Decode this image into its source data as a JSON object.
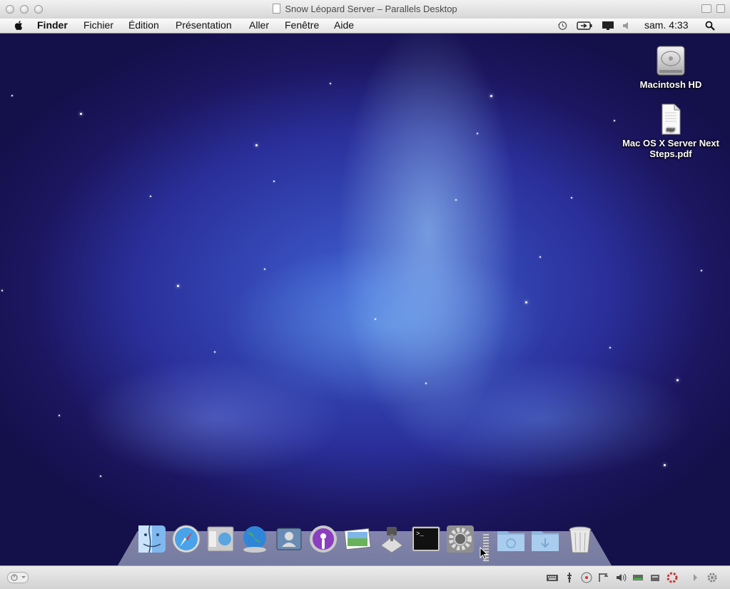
{
  "window": {
    "title": "Snow Léopard Server – Parallels Desktop"
  },
  "menubar": {
    "app_name": "Finder",
    "items": [
      "Fichier",
      "Édition",
      "Présentation",
      "Aller",
      "Fenêtre",
      "Aide"
    ],
    "clock": "sam. 4:33"
  },
  "desktop": {
    "icons": [
      {
        "label": "Macintosh HD",
        "icon": "hard-drive-icon"
      },
      {
        "label": "Mac OS X Server Next Steps.pdf",
        "icon": "pdf-document-icon",
        "badge": "PDF"
      }
    ]
  },
  "dock": {
    "items": [
      {
        "name": "finder",
        "icon": "finder-icon"
      },
      {
        "name": "safari",
        "icon": "safari-compass-icon"
      },
      {
        "name": "preview",
        "icon": "preview-icon"
      },
      {
        "name": "globe",
        "icon": "globe-icon"
      },
      {
        "name": "directory",
        "icon": "directory-icon"
      },
      {
        "name": "podcast",
        "icon": "podcast-icon"
      },
      {
        "name": "photos",
        "icon": "photo-icon"
      },
      {
        "name": "server-app",
        "icon": "xgrid-icon"
      },
      {
        "name": "terminal",
        "icon": "terminal-icon",
        "prompt": ">_"
      },
      {
        "name": "system-preferences",
        "icon": "gear-icon"
      },
      {
        "name": "applications-folder",
        "icon": "folder-icon"
      },
      {
        "name": "downloads-folder",
        "icon": "downloads-folder-icon"
      },
      {
        "name": "trash",
        "icon": "trash-icon"
      }
    ]
  },
  "colors": {
    "desktop_base": "#2a2f9a",
    "aurora": "#aadcff",
    "menubar": "#efefef"
  }
}
